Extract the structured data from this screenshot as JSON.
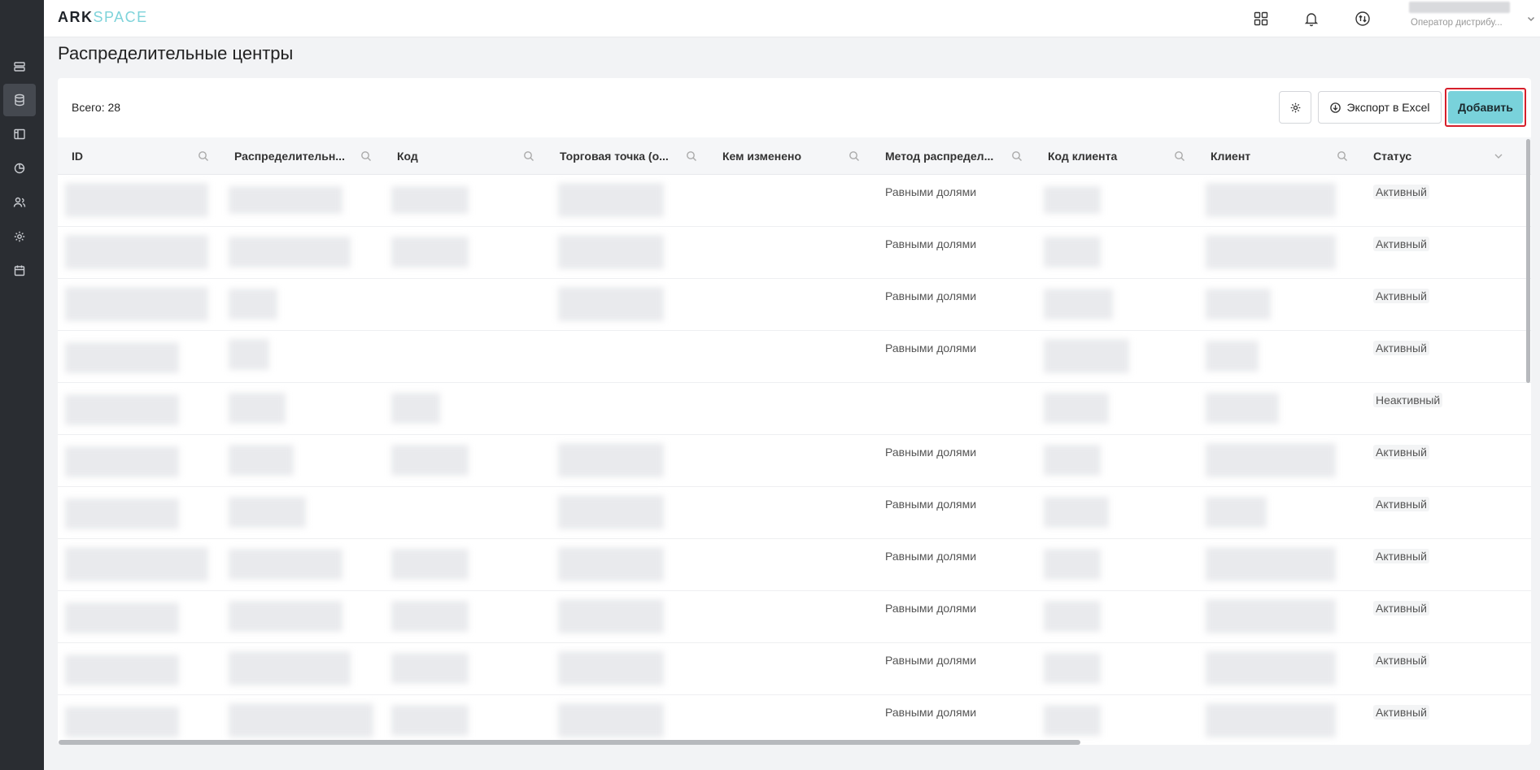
{
  "logo": {
    "ark": "ARK",
    "space": "SPACE"
  },
  "header": {
    "icons": [
      "apps-grid-icon",
      "bell-icon",
      "sync-icon"
    ],
    "user_role": "Оператор дистрибу..."
  },
  "page": {
    "title": "Распределительные центры"
  },
  "toolbar": {
    "total_label": "Всего: 28",
    "export_label": "Экспорт в Excel",
    "add_label": "Добавить"
  },
  "sidebar": {
    "items": [
      "list-icon",
      "database-icon",
      "layout-icon",
      "pie-icon",
      "users-icon",
      "gear-icon",
      "calendar-icon"
    ],
    "active_index": 1
  },
  "table": {
    "columns": [
      {
        "label": "ID",
        "searchable": true
      },
      {
        "label": "Распределительн...",
        "searchable": true
      },
      {
        "label": "Код",
        "searchable": true
      },
      {
        "label": "Торговая точка (о...",
        "searchable": true
      },
      {
        "label": "Кем изменено",
        "searchable": true
      },
      {
        "label": "Метод распредел...",
        "searchable": true
      },
      {
        "label": "Код клиента",
        "searchable": true
      },
      {
        "label": "Клиент",
        "searchable": true
      },
      {
        "label": "Статус",
        "searchable": false
      }
    ],
    "rows": [
      {
        "method": "Равными долями",
        "status": "Активный"
      },
      {
        "method": "Равными долями",
        "status": "Активный"
      },
      {
        "method": "Равными долями",
        "status": "Активный"
      },
      {
        "method": "Равными долями",
        "status": "Активный"
      },
      {
        "method": "",
        "status": "Неактивный"
      },
      {
        "method": "Равными долями",
        "status": "Активный"
      },
      {
        "method": "Равными долями",
        "status": "Активный"
      },
      {
        "method": "Равными долями",
        "status": "Активный"
      },
      {
        "method": "Равными долями",
        "status": "Активный"
      },
      {
        "method": "Равными долями",
        "status": "Активный"
      },
      {
        "method": "Равными долями",
        "status": "Активный"
      }
    ]
  },
  "colors": {
    "sidebar_bg": "#2a2d32",
    "accent": "#79d2db",
    "highlight_border": "#d61f2b"
  }
}
